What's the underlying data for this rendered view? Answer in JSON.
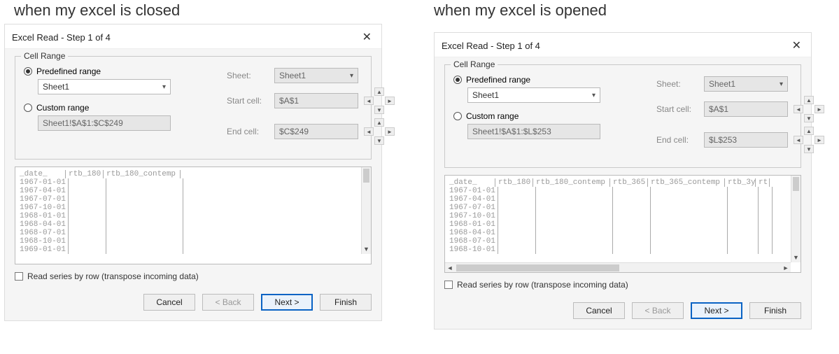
{
  "captions": {
    "left": "when my excel is closed",
    "right": "when my excel is opened"
  },
  "dialog_title": "Excel Read - Step 1 of 4",
  "fieldset_legend": "Cell Range",
  "radio_predefined": "Predefined range",
  "radio_custom": "Custom range",
  "sheet_combo": "Sheet1",
  "label_sheet": "Sheet:",
  "label_startcell": "Start cell:",
  "label_endcell": "End cell:",
  "sheet_value_right": "Sheet1",
  "start_cell": "$A$1",
  "left_panel": {
    "custom_range_value": "Sheet1!$A$1:$C$249",
    "end_cell": "$C$249",
    "columns": [
      "_date_",
      "rtb_180",
      "rtb_180_contemp"
    ],
    "rows": [
      "1967-01-01",
      "1967-04-01",
      "1967-07-01",
      "1967-10-01",
      "1968-01-01",
      "1968-04-01",
      "1968-07-01",
      "1968-10-01",
      "1969-01-01"
    ]
  },
  "right_panel": {
    "custom_range_value": "Sheet1!$A$1:$L$253",
    "end_cell": "$L$253",
    "columns": [
      "_date_",
      "rtb_180",
      "rtb_180_contemp",
      "rtb_365",
      "rtb_365_contemp",
      "rtb_3y",
      "rt"
    ],
    "rows": [
      "1967-01-01",
      "1967-04-01",
      "1967-07-01",
      "1967-10-01",
      "1968-01-01",
      "1968-04-01",
      "1968-07-01",
      "1968-10-01"
    ]
  },
  "checkbox_label": "Read series by row (transpose incoming data)",
  "buttons": {
    "cancel": "Cancel",
    "back": "< Back",
    "next": "Next >",
    "finish": "Finish"
  }
}
